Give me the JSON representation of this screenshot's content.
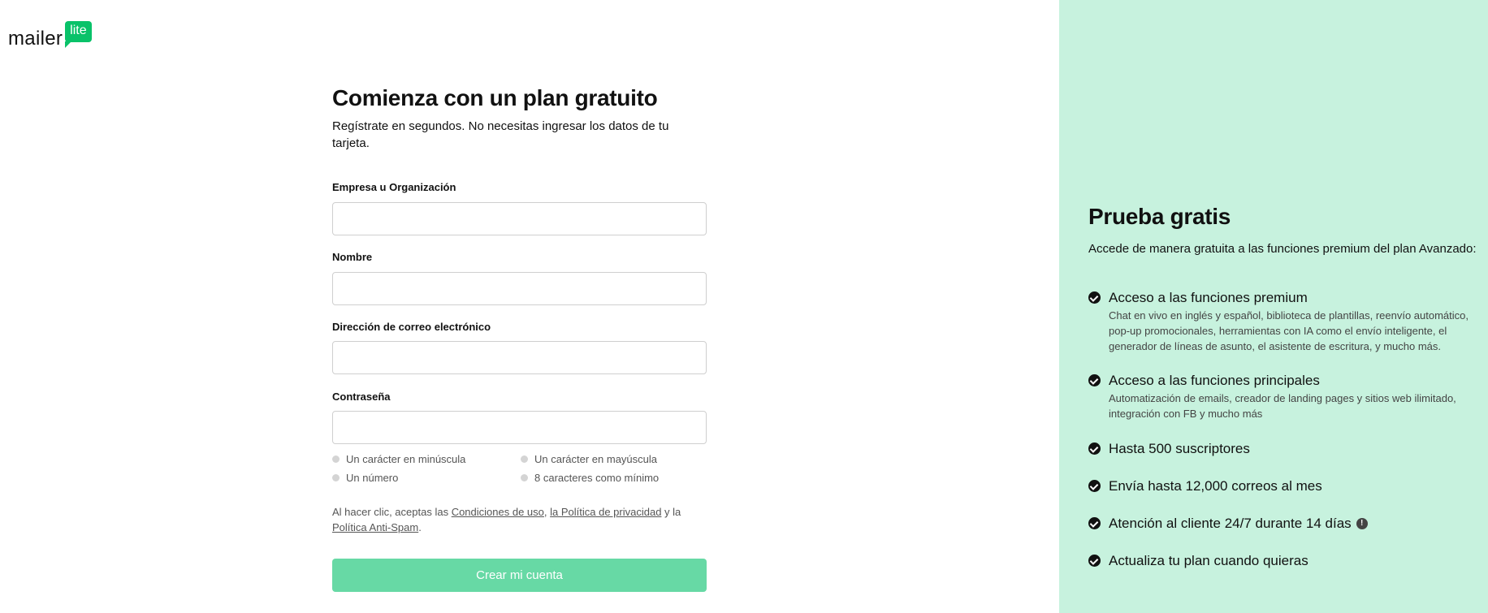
{
  "logo": {
    "word": "mailer",
    "badge": "lite"
  },
  "form": {
    "title": "Comienza con un plan gratuito",
    "subtitle": "Regístrate en segundos. No necesitas ingresar los datos de tu tarjeta.",
    "fields": {
      "company": {
        "label": "Empresa u Organización",
        "value": "",
        "placeholder": ""
      },
      "name": {
        "label": "Nombre",
        "value": "",
        "placeholder": ""
      },
      "email": {
        "label": "Dirección de correo electrónico",
        "value": "",
        "placeholder": ""
      },
      "password": {
        "label": "Contraseña",
        "value": "",
        "placeholder": ""
      }
    },
    "password_requirements": [
      "Un carácter en minúscula",
      "Un carácter en mayúscula",
      "Un número",
      "8 caracteres como mínimo"
    ],
    "terms": {
      "prefix": "Al hacer clic, aceptas las ",
      "link_terms": "Condiciones de uso",
      "sep1": ", ",
      "link_privacy": "la Política de privacidad",
      "sep2": " y la ",
      "link_antispam": "Política Anti-Spam",
      "suffix": "."
    },
    "submit_label": "Crear mi cuenta"
  },
  "side": {
    "title": "Prueba gratis",
    "intro": "Accede de manera gratuita a las funciones premium del plan Avanzado:",
    "features": [
      {
        "title": "Acceso a las funciones premium",
        "desc": "Chat en vivo en inglés y español, biblioteca de plantillas, reenvío automático, pop-up promocionales, herramientas con IA como el envío inteligente, el generador de líneas de asunto, el asistente de escritura, y mucho más."
      },
      {
        "title": "Acceso a las funciones principales",
        "desc": "Automatización de emails, creador de landing pages y sitios web ilimitado, integración con FB y mucho más"
      },
      {
        "title": "Hasta 500 suscriptores"
      },
      {
        "title": "Envía hasta 12,000 correos al mes"
      },
      {
        "title": "Atención al cliente 24/7 durante 14 días",
        "info_glyph": "!"
      },
      {
        "title": "Actualiza tu plan cuando quieras"
      }
    ]
  },
  "colors": {
    "brand_green": "#09c269",
    "side_panel_bg": "#c7f2de",
    "button_bg": "#67d9a5"
  },
  "icons": {
    "check": "check-circle-icon",
    "info": "info-icon"
  }
}
